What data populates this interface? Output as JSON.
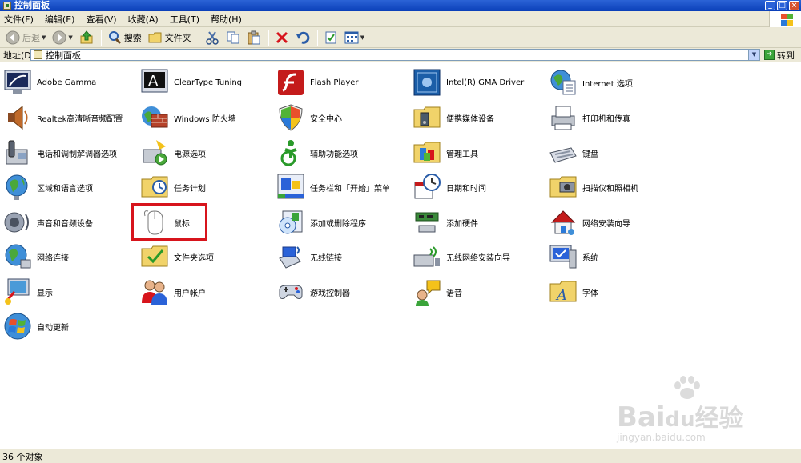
{
  "window": {
    "title": "控制面板"
  },
  "menu": [
    "文件(F)",
    "编辑(E)",
    "查看(V)",
    "收藏(A)",
    "工具(T)",
    "帮助(H)"
  ],
  "toolbar": {
    "back": "后退",
    "search": "搜索",
    "folders": "文件夹"
  },
  "address": {
    "label": "地址(D)",
    "value": "控制面板",
    "go": "转到"
  },
  "items": [
    [
      "Adobe Gamma",
      "ClearType Tuning",
      "Flash Player",
      "Intel(R) GMA Driver",
      "Internet 选项"
    ],
    [
      "Realtek高清晰音频配置",
      "Windows 防火墙",
      "安全中心",
      "便携媒体设备",
      "打印机和传真"
    ],
    [
      "电话和调制解调器选项",
      "电源选项",
      "辅助功能选项",
      "管理工具",
      "键盘"
    ],
    [
      "区域和语言选项",
      "任务计划",
      "任务栏和「开始」菜单",
      "日期和时间",
      "扫描仪和照相机"
    ],
    [
      "声音和音频设备",
      "鼠标",
      "添加或删除程序",
      "添加硬件",
      "网络安装向导"
    ],
    [
      "网络连接",
      "文件夹选项",
      "无线链接",
      "无线网络安装向导",
      "系统"
    ],
    [
      "显示",
      "用户帐户",
      "游戏控制器",
      "语音",
      "字体"
    ],
    [
      "自动更新"
    ]
  ],
  "highlight": "鼠标",
  "status": {
    "count": "36 个对象"
  },
  "watermark": {
    "brand": "Bai",
    "cn": "经验",
    "site": "jingyan.baidu.com"
  },
  "icons": [
    [
      "monitor-icon",
      "cleartype-icon",
      "flash-icon",
      "intel-driver-icon",
      "internet-options-icon"
    ],
    [
      "speaker-icon",
      "firewall-icon",
      "shield-icon",
      "media-device-icon",
      "printer-icon"
    ],
    [
      "phone-icon",
      "power-icon",
      "accessibility-icon",
      "admin-tools-icon",
      "keyboard-icon"
    ],
    [
      "globe-icon",
      "scheduled-tasks-icon",
      "taskbar-icon",
      "clock-icon",
      "scanner-icon"
    ],
    [
      "sound-icon",
      "mouse-icon",
      "add-remove-icon",
      "hardware-icon",
      "house-icon"
    ],
    [
      "network-icon",
      "folder-options-icon",
      "wireless-link-icon",
      "wireless-wizard-icon",
      "system-icon"
    ],
    [
      "display-icon",
      "users-icon",
      "game-controller-icon",
      "speech-icon",
      "fonts-icon"
    ],
    [
      "windows-update-icon"
    ]
  ]
}
